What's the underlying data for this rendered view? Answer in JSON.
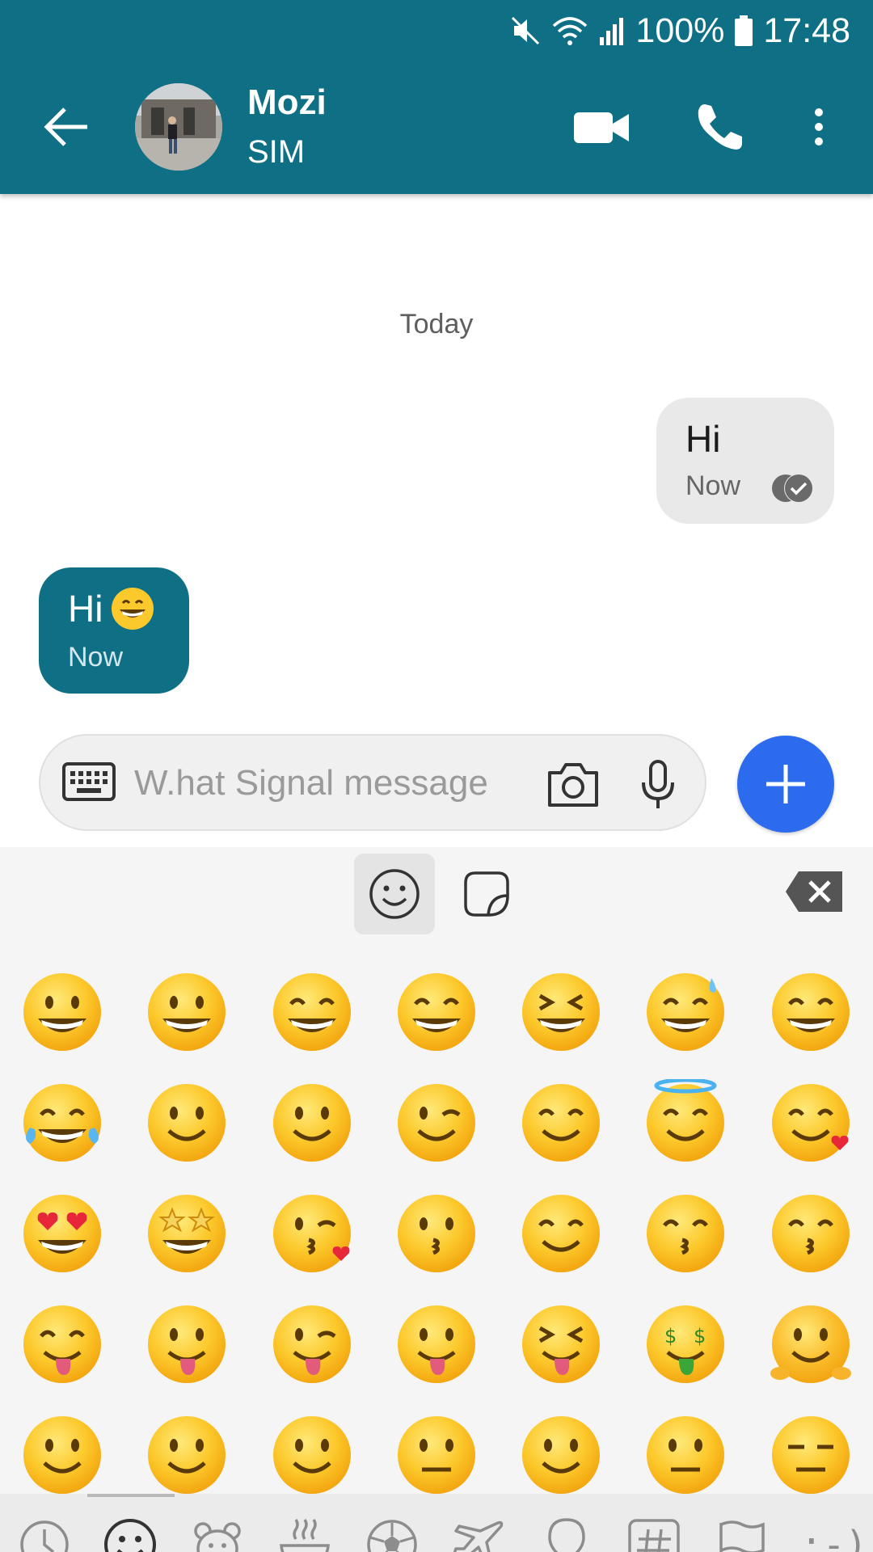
{
  "status_bar": {
    "battery": "100%",
    "time": "17:48"
  },
  "header": {
    "back_icon": "arrow-left-icon",
    "contact_name": "Mozi",
    "contact_subtitle": "SIM",
    "video_icon": "video-call-icon",
    "phone_icon": "phone-icon",
    "more_icon": "more-vert-icon",
    "color": "#0f7085"
  },
  "conversation": {
    "date_divider": "Today",
    "messages": [
      {
        "direction": "outgoing",
        "text": "Hi",
        "time": "Now",
        "status": "delivered"
      },
      {
        "direction": "incoming",
        "text": "Hi",
        "emoji": "grinning-face-with-smiling-eyes",
        "time": "Now"
      }
    ]
  },
  "composer": {
    "placeholder": "W.hat Signal message",
    "value": "",
    "keyboard_icon": "keyboard-icon",
    "camera_icon": "camera-icon",
    "mic_icon": "microphone-icon",
    "send_icon": "plus-icon",
    "send_color": "#2c6bed"
  },
  "emoji_panel": {
    "tabs": [
      {
        "name": "emoji",
        "icon": "smiley-icon",
        "active": true
      },
      {
        "name": "stickers",
        "icon": "sticker-icon",
        "active": false
      }
    ],
    "backspace_icon": "backspace-icon",
    "grid": [
      [
        "grinning",
        "grinning-big-eyes",
        "grinning-smiling-eyes",
        "beaming",
        "squinting",
        "grinning-sweat",
        "rolling-on-floor-laughing"
      ],
      [
        "tears-of-joy",
        "slightly-smiling",
        "upside-down",
        "winking",
        "smiling-eyes",
        "halo",
        "smiling-with-hearts"
      ],
      [
        "heart-eyes",
        "star-struck",
        "face-blowing-kiss",
        "kissing",
        "smiling",
        "kissing-closed-eyes",
        "kissing-smiling-eyes"
      ],
      [
        "savoring-food",
        "tongue",
        "winking-tongue",
        "zany",
        "squinting-tongue",
        "money-mouth",
        "hugging"
      ],
      [
        "hand-over-mouth",
        "shushing",
        "thinking",
        "zipper-mouth",
        "raised-eyebrow",
        "neutral",
        "expressionless"
      ]
    ],
    "categories": [
      "recents-icon",
      "smileys-icon",
      "animals-icon",
      "food-icon",
      "activity-icon",
      "travel-icon",
      "objects-icon",
      "symbols-icon",
      "flags-icon",
      "emoticons"
    ],
    "emoticon_label": ":-)"
  }
}
